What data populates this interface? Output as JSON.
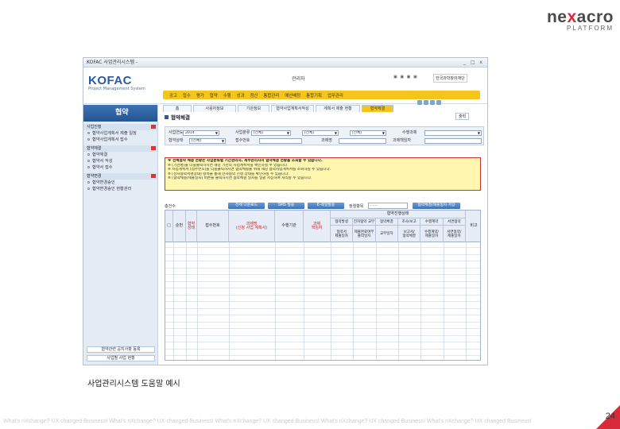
{
  "brand": {
    "logo": "ne",
    "logo_x": "x",
    "logo_end": "acro",
    "sub": "PLATFORM"
  },
  "window": {
    "title": "KOFAC 사업관리시스템 -",
    "controls": "_ □ x"
  },
  "app": {
    "logo": "KOFAC",
    "logo_sub": "Project Management System",
    "user": "관리자",
    "head_icons": "▣ ▣ ▣ ▣",
    "company": "한국과학창의재단",
    "menu": [
      "공고",
      "접수",
      "평가",
      "협약",
      "수행",
      "성과",
      "정산",
      "통합관리",
      "예산배정",
      "통합기획",
      "업무관리"
    ],
    "sub_buttons": [
      "",
      "",
      "",
      ""
    ]
  },
  "sidebar": {
    "title": "협약",
    "groups": [
      {
        "label": "사업진행",
        "items": [
          "협약사업계획서 제출 일정",
          "협약사업계획서 접수"
        ]
      },
      {
        "label": "협약체결",
        "items": [
          "협약체결",
          "협약서 작성",
          "협약서 접수"
        ]
      },
      {
        "label": "협약변경",
        "items": [
          "협약변경승인",
          "협약변경승인 현황관리"
        ]
      }
    ],
    "bottom": [
      "협약관련 공지사항 등록",
      "사업별 사업 현황"
    ]
  },
  "tabs": [
    "홈",
    "사용자정보",
    "기관정보",
    "협약사업계획서작성",
    "계획서 제출 현황",
    "협약체결"
  ],
  "page_title": "협약체결",
  "print_button": "출력",
  "search": {
    "row1": [
      {
        "label": "사업연도",
        "value": "2014"
      },
      {
        "label": "사업분류",
        "value": "[전체]"
      },
      {
        "label": "",
        "value": "[전체]"
      },
      {
        "label": "",
        "value": "[전체]"
      },
      {
        "label": "수행과제",
        "value": ""
      }
    ],
    "row2": [
      {
        "label": "협약상태",
        "value": "[전체]"
      },
      {
        "label": "접수번호",
        "value": ""
      },
      {
        "label": "과제명",
        "value": ""
      },
      {
        "label": "과제책임자",
        "value": ""
      }
    ]
  },
  "notice": [
    "※ 전체협약 체결 현황은 사업분류별 기간관리자, 세부관리자의 협약체결 현황을 조회할 수 있습니다.",
    "※ [기관명]을 더블클릭하시면 해당 기관의 사업계획서를 확인하실 수 있습니다.",
    "※ 사업계획서 [접수번호]를 더블클릭하시면 협약체결을 위해 해당 협약사업계획서를 조회하실 수 있습니다.",
    "※ [전자협약서명상태] 항목을 통해 전자협약 진행 상태를 확인하실 수 있습니다.",
    "※ [협약체결/제출일자] 버튼을 클릭하시면 협약체결 일자를 일괄 저장하여 처리할 수 있습니다."
  ],
  "toolbar": {
    "count": "총건수",
    "buttons": [
      "전체 다운로드",
      "SMS 발송",
      "E-메일발송"
    ],
    "sort_label": "정렬항목",
    "sort_value": "- - -",
    "save_button": "협약체결/제출일자 저장"
  },
  "grid": {
    "headers": [
      "□",
      "순번",
      "협약\n상태",
      "접수번호",
      "과제명\n(신청 사업 계획서)",
      "수행기관",
      "과제\n책임자"
    ],
    "group_header": "협약진행상태",
    "sub_headers": [
      "협약발생",
      "전자협약 교부",
      "협약체결",
      "조사/보고",
      "수행계약",
      "서면협약"
    ],
    "sub_sub": [
      "협약서\n제출일자",
      "제출완료여부\n출력일자",
      "교부일자",
      "보고서/\n협약체결",
      "수행계약/\n제출일자",
      "서면협약/\n제출일자"
    ],
    "last": "비고",
    "row_count": 17
  },
  "caption": "사업관리시스템 도움말 예시",
  "footer_text": "What's nXchange? UX changed Business! What's nXchange? UX changed Business! What's nXchange? UX changed Business! What's nXchange? UX changed Business! What's nXchange? UX changed Business!",
  "page_number": "24",
  "colors": {
    "menu": "#f4c61c",
    "brand_red": "#d82a3a",
    "blue": "#2a5aa6"
  }
}
